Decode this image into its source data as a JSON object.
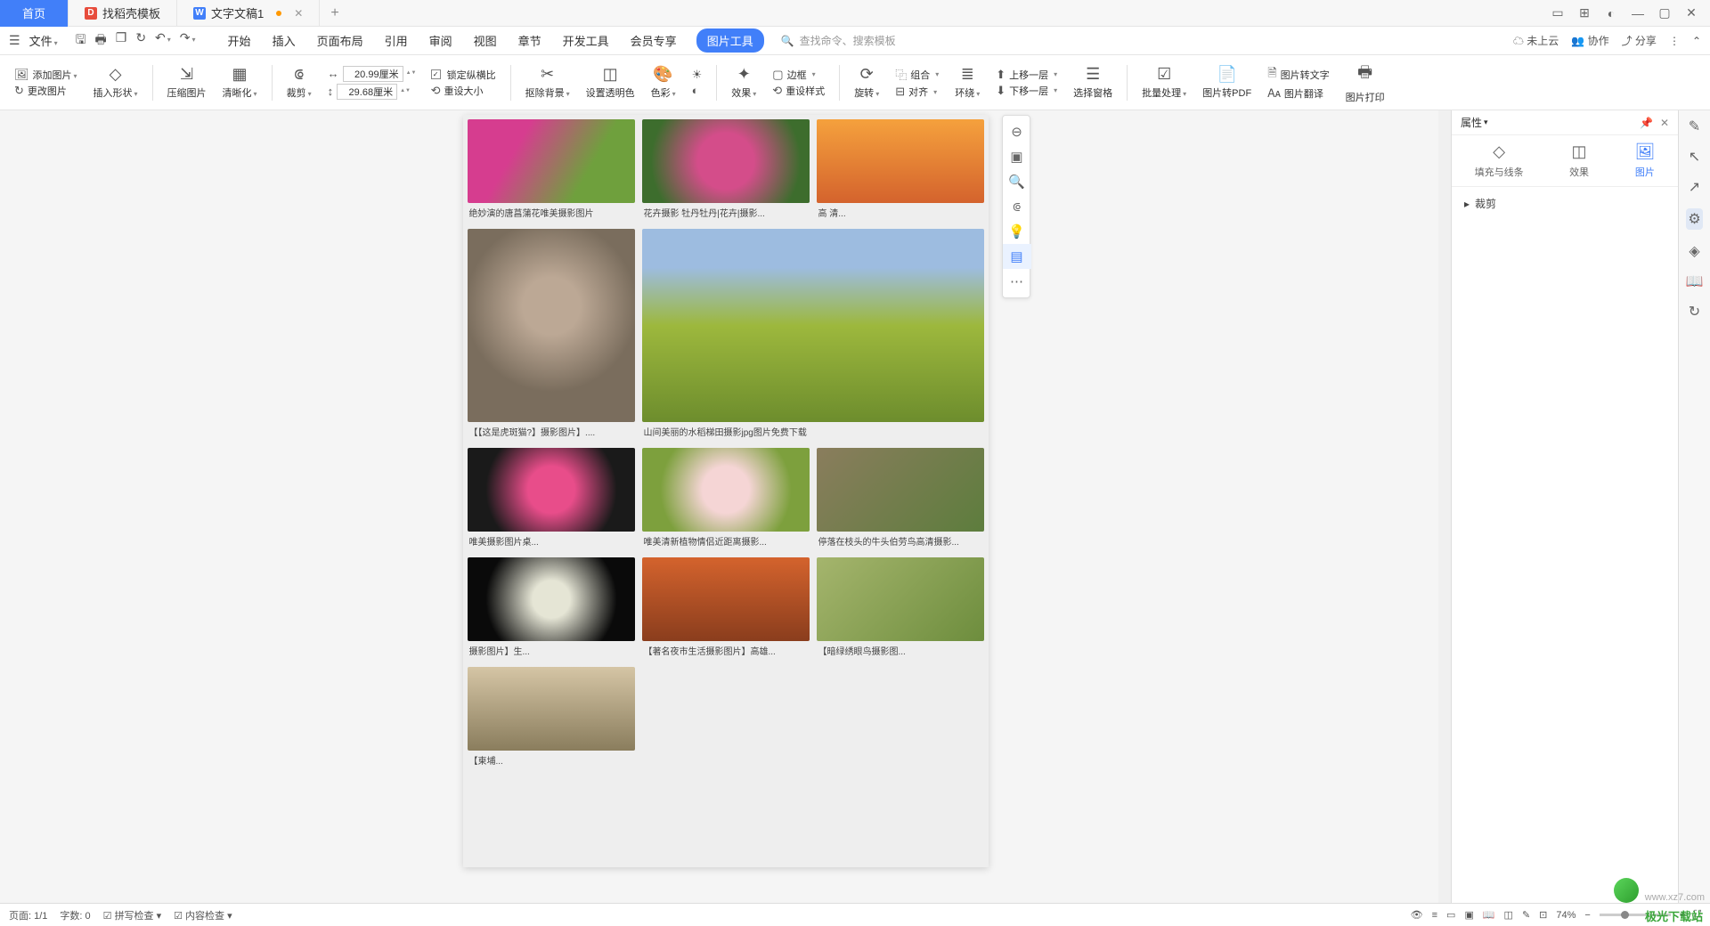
{
  "titlebar": {
    "home": "首页",
    "tab1": "找稻壳模板",
    "tab2": "文字文稿1"
  },
  "menubar": {
    "file": "文件",
    "tabs": [
      "开始",
      "插入",
      "页面布局",
      "引用",
      "审阅",
      "视图",
      "章节",
      "开发工具",
      "会员专享",
      "图片工具"
    ],
    "search_hint": "查找命令、搜索模板",
    "cloud": "未上云",
    "coop": "协作",
    "share": "分享"
  },
  "ribbon": {
    "add_pic": "添加图片",
    "change_pic": "更改图片",
    "insert_shape": "插入形状",
    "compress": "压缩图片",
    "clarity": "清晰化",
    "crop": "裁剪",
    "width": "20.99厘米",
    "height": "29.68厘米",
    "lock_ratio": "锁定纵横比",
    "reset_size": "重设大小",
    "remove_bg": "抠除背景",
    "transparent": "设置透明色",
    "color": "色彩",
    "effect": "效果",
    "reset_style": "重设样式",
    "border": "边框",
    "rotate": "旋转",
    "combine": "组合",
    "align": "对齐",
    "wrap": "环绕",
    "up_layer": "上移一层",
    "down_layer": "下移一层",
    "sel_pane": "选择窗格",
    "batch": "批量处理",
    "to_pdf": "图片转PDF",
    "to_text": "图片转文字",
    "translate": "图片翻译",
    "print": "图片打印"
  },
  "rpanel": {
    "title": "属性",
    "tab1": "填充与线条",
    "tab2": "效果",
    "tab3": "图片",
    "crop": "裁剪"
  },
  "captions": {
    "c1": "绝妙演的唐菖蒲花唯美摄影图片",
    "c2": "花卉摄影 牡丹牡丹|花卉|摄影...",
    "c3": "高 清...",
    "c4": "【【这是虎斑猫?】摄影图片】....",
    "c5": "山间美丽的水稻梯田摄影jpg图片免费下载",
    "c6": "唯美摄影图片桌...",
    "c7": "唯美清新植物情侣近距离摄影...",
    "c8": "停落在枝头的牛头伯劳鸟高清摄影...",
    "c9": "摄影图片】生...",
    "c10": "【著名夜市生活摄影图片】高雄...",
    "c11": "【暗绿绣眼鸟摄影图...",
    "c12": "【柬埔..."
  },
  "status": {
    "page": "页面: 1/1",
    "words": "字数: 0",
    "spell": "拼写检查",
    "content": "内容检查",
    "zoom": "74%"
  },
  "watermark": "极光下载站",
  "watermark2": "www.xz7.com"
}
